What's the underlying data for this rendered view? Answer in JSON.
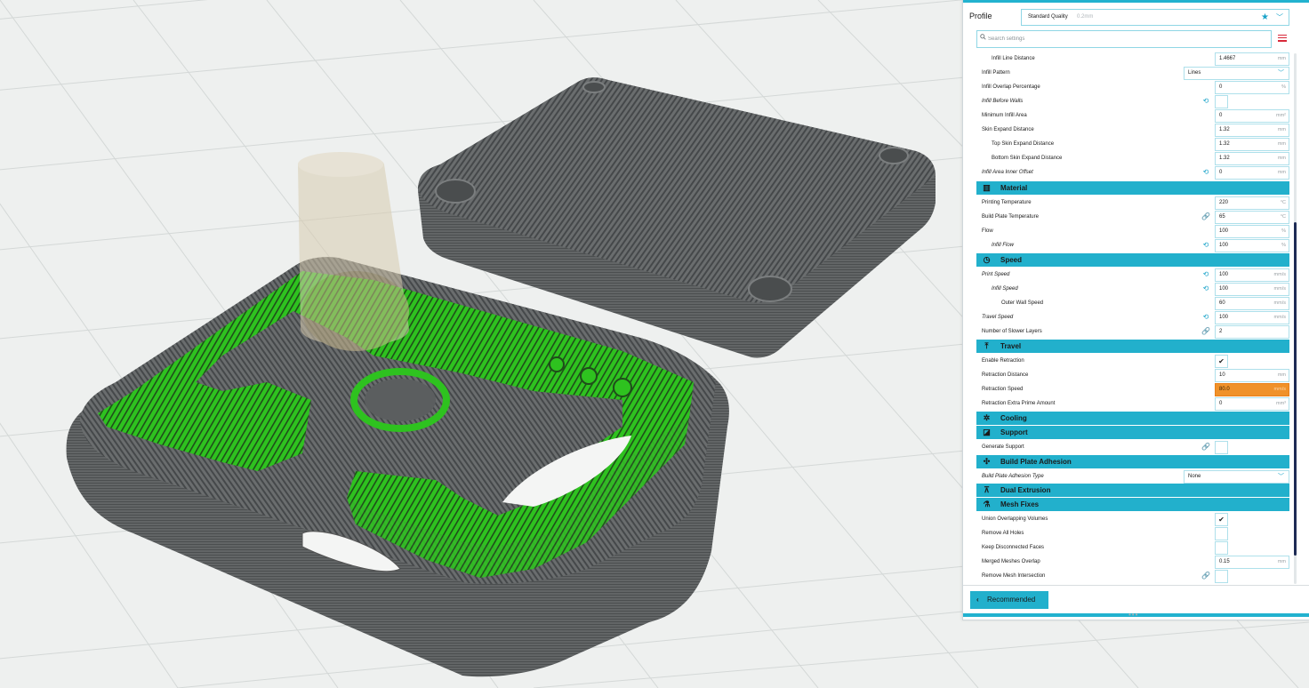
{
  "profile": {
    "label": "Profile",
    "name": "Standard Quality",
    "layer": "0.2mm",
    "star_icon": "star-icon",
    "chevron_icon": "chevron-down-icon"
  },
  "search": {
    "placeholder": "Search settings"
  },
  "infill": {
    "line_distance": {
      "label": "Infill Line Distance",
      "value": "1.4667",
      "unit": "mm"
    },
    "pattern": {
      "label": "Infill Pattern",
      "value": "Lines"
    },
    "overlap": {
      "label": "Infill Overlap Percentage",
      "value": "0",
      "unit": "%"
    },
    "before_walls": {
      "label": "Infill Before Walls"
    },
    "min_area": {
      "label": "Minimum Infill Area",
      "value": "0",
      "unit": "mm²"
    },
    "skin_expand": {
      "label": "Skin Expand Distance",
      "value": "1.32",
      "unit": "mm"
    },
    "top_skin_expand": {
      "label": "Top Skin Expand Distance",
      "value": "1.32",
      "unit": "mm"
    },
    "bottom_skin_expand": {
      "label": "Bottom Skin Expand Distance",
      "value": "1.32",
      "unit": "mm"
    },
    "area_inner_offset": {
      "label": "Infill Area Inner Offset",
      "value": "0",
      "unit": "mm"
    }
  },
  "material": {
    "title": "Material",
    "printing_temp": {
      "label": "Printing Temperature",
      "value": "220",
      "unit": "°C"
    },
    "plate_temp": {
      "label": "Build Plate Temperature",
      "value": "65",
      "unit": "°C"
    },
    "flow": {
      "label": "Flow",
      "value": "100",
      "unit": "%"
    },
    "infill_flow": {
      "label": "Infill Flow",
      "value": "100",
      "unit": "%"
    }
  },
  "speed": {
    "title": "Speed",
    "print_speed": {
      "label": "Print Speed",
      "value": "100",
      "unit": "mm/s"
    },
    "infill_speed": {
      "label": "Infill Speed",
      "value": "100",
      "unit": "mm/s"
    },
    "outer_wall_speed": {
      "label": "Outer Wall Speed",
      "value": "60",
      "unit": "mm/s"
    },
    "travel_speed": {
      "label": "Travel Speed",
      "value": "100",
      "unit": "mm/s"
    },
    "slower_layers": {
      "label": "Number of Slower Layers",
      "value": "2"
    }
  },
  "travel": {
    "title": "Travel",
    "enable_retraction": {
      "label": "Enable Retraction",
      "checked": true
    },
    "retraction_distance": {
      "label": "Retraction Distance",
      "value": "10",
      "unit": "mm"
    },
    "retraction_speed": {
      "label": "Retraction Speed",
      "value": "80.0",
      "unit": "mm/s",
      "highlight_color": "#f0922a"
    },
    "extra_prime": {
      "label": "Retraction Extra Prime Amount",
      "value": "0",
      "unit": "mm³"
    }
  },
  "cooling": {
    "title": "Cooling"
  },
  "support": {
    "title": "Support",
    "generate": {
      "label": "Generate Support",
      "checked": false
    }
  },
  "adhesion": {
    "title": "Build Plate Adhesion",
    "type": {
      "label": "Build Plate Adhesion Type",
      "value": "None"
    }
  },
  "dual": {
    "title": "Dual Extrusion"
  },
  "mesh": {
    "title": "Mesh Fixes",
    "union": {
      "label": "Union Overlapping Volumes",
      "checked": true
    },
    "remove_holes": {
      "label": "Remove All Holes",
      "checked": false
    },
    "keep_disconnected": {
      "label": "Keep Disconnected Faces",
      "checked": false
    },
    "merged_overlap": {
      "label": "Merged Meshes Overlap",
      "value": "0.15",
      "unit": "mm"
    },
    "remove_intersection": {
      "label": "Remove Mesh Intersection",
      "checked": false
    }
  },
  "footer": {
    "recommended_label": "Recommended"
  },
  "colors": {
    "accent": "#22b0cc",
    "highlight": "#f0922a",
    "infill_green": "#2ec21f",
    "part_gray": "#5f6263"
  }
}
